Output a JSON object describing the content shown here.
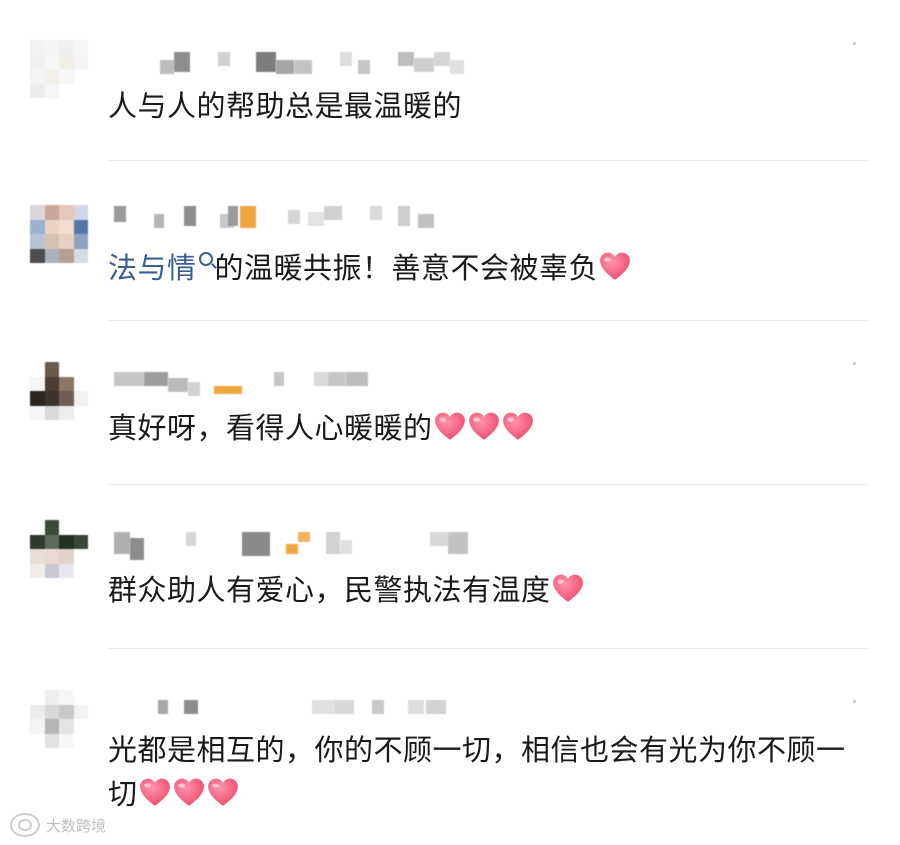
{
  "comments": [
    {
      "text": "人与人的帮助总是最温暖的"
    },
    {
      "link_text": "法与情",
      "text": "的温暖共振！善意不会被辜负"
    },
    {
      "text": "真好呀，看得人心暖暖的"
    },
    {
      "text": "群众助人有爱心，民警执法有温度"
    },
    {
      "text": "光都是相互的，你的不顾一切，相信也会有光为你不顾一切"
    }
  ],
  "icons": {
    "heart": "heart-emoji",
    "search": "search-icon"
  },
  "colors": {
    "text": "#1a1a1a",
    "link": "#3a5f93",
    "heart": "#f25a7a",
    "divider": "#ececec"
  },
  "watermark": {
    "text": "大数跨境"
  }
}
